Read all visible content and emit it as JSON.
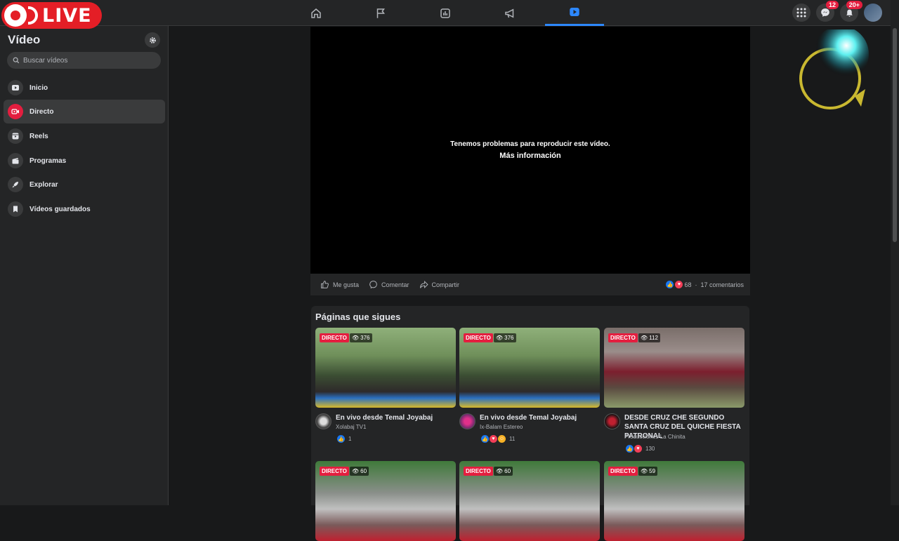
{
  "overlay": {
    "live_label": "LIVE"
  },
  "topbar": {
    "tabs": [
      {
        "icon": "home-icon"
      },
      {
        "icon": "flag-icon"
      },
      {
        "icon": "stats-icon"
      },
      {
        "icon": "megaphone-icon"
      },
      {
        "icon": "video-icon",
        "active": true
      }
    ],
    "messenger_badge": "12",
    "notifications_badge": "20+"
  },
  "sidebar": {
    "title": "Vídeo",
    "search_placeholder": "Buscar vídeos",
    "items": [
      {
        "label": "Inicio",
        "icon": "play-icon"
      },
      {
        "label": "Directo",
        "icon": "live-camera-icon",
        "active": true
      },
      {
        "label": "Reels",
        "icon": "reels-icon"
      },
      {
        "label": "Programas",
        "icon": "clapper-icon"
      },
      {
        "label": "Explorar",
        "icon": "rocket-icon"
      },
      {
        "label": "Vídeos guardados",
        "icon": "bookmark-icon"
      }
    ]
  },
  "player": {
    "error_message": "Tenemos problemas para reproducir este vídeo.",
    "more_info": "Más información"
  },
  "actions": {
    "like": "Me gusta",
    "comment": "Comentar",
    "share": "Compartir",
    "reactions_count": "68",
    "separator": "·",
    "comments_count": "17 comentarios"
  },
  "following": {
    "title": "Páginas que sigues",
    "live_badge": "DIRECTO",
    "cards": [
      {
        "views": "376",
        "title": "En vivo desde Temal Joyabaj",
        "page": "Xolabaj TV1",
        "reactions": "1"
      },
      {
        "views": "376",
        "title": "En vivo desde Temal Joyabaj",
        "page": "Ix-Balam Estereo",
        "reactions": "11"
      },
      {
        "views": "112",
        "title": "DESDE CRUZ CHE SEGUNDO SANTA CRUZ DEL QUICHE FIESTA PATRONAL",
        "page": "Producciones La Chinita",
        "reactions": "130"
      }
    ],
    "next_row": [
      {
        "views": "60"
      },
      {
        "views": "60"
      },
      {
        "views": "59"
      }
    ]
  },
  "colors": {
    "accent": "#2d88ff",
    "live_red": "#e41e3f",
    "background": "#18191a",
    "surface": "#242526"
  }
}
